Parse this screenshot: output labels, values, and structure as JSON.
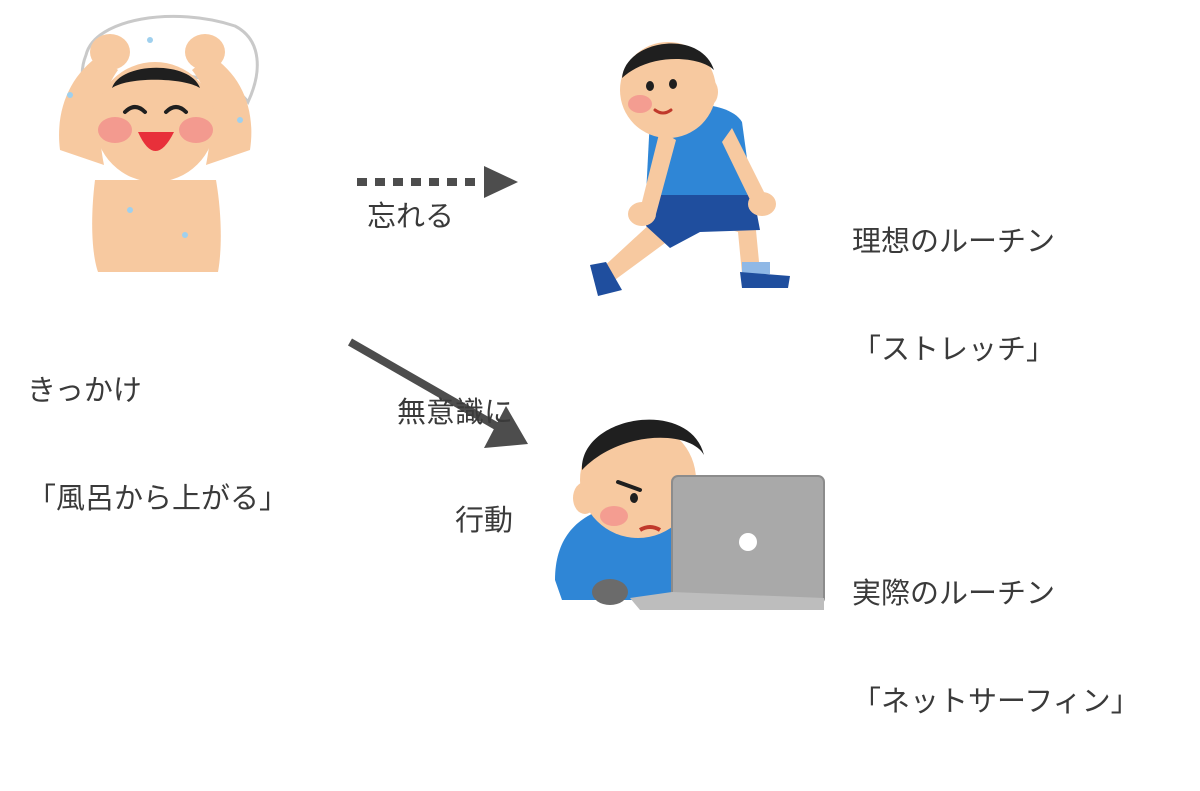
{
  "trigger": {
    "line1": "きっかけ",
    "line2": "「風呂から上がる」"
  },
  "ideal_routine": {
    "line1": "理想のルーチン",
    "line2": "「ストレッチ」"
  },
  "actual_routine": {
    "line1": "実際のルーチン",
    "line2": "「ネットサーフィン」"
  },
  "arrow_forget": {
    "label": "忘れる",
    "style": "dotted"
  },
  "arrow_unconscious": {
    "line1": "無意識に",
    "line2": "行動",
    "style": "solid"
  },
  "colors": {
    "text": "#3a3a3a",
    "arrow": "#4d4d4d",
    "skin": "#f7c9a0",
    "hair": "#1f1f1f",
    "shirt_blue": "#2f86d6",
    "shorts_navy": "#1f4e9e",
    "laptop_gray": "#a9a9a9"
  }
}
